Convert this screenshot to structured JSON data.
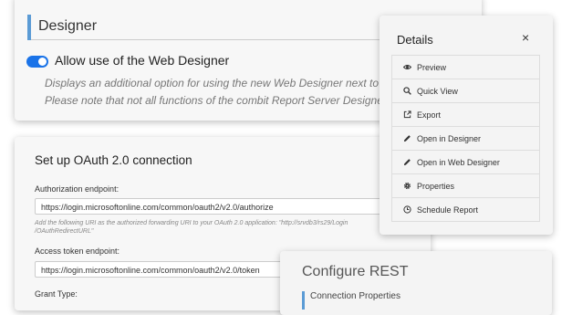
{
  "designer": {
    "title": "Designer",
    "toggle_label": "Allow use of the Web Designer",
    "desc_line1": "Displays an additional option for using the new Web Designer next to",
    "desc_line2": "Please note that not all functions of the combit Report Server Designer"
  },
  "oauth": {
    "title": "Set up OAuth 2.0 connection",
    "auth_label": "Authorization endpoint:",
    "auth_value": "https://login.microsoftonline.com/common/oauth2/v2.0/authorize",
    "hint": "Add the following URI as the authorized forwarding URI to your OAuth 2.0 application: \"http://srvdb3/rs29/Login /OAuthRedirectURL\"",
    "token_label": "Access token endpoint:",
    "token_value": "https://login.microsoftonline.com/common/oauth2/v2.0/token",
    "grant_label": "Grant Type:"
  },
  "rest": {
    "title": "Configure REST",
    "subtitle": "Connection Properties"
  },
  "details": {
    "title": "Details",
    "close": "×",
    "items": [
      {
        "label": "Preview",
        "icon": "eye-icon"
      },
      {
        "label": "Quick View",
        "icon": "magnifier-icon"
      },
      {
        "label": "Export",
        "icon": "export-icon"
      },
      {
        "label": "Open in Designer",
        "icon": "pencil-icon"
      },
      {
        "label": "Open in Web Designer",
        "icon": "pencil-icon"
      },
      {
        "label": "Properties",
        "icon": "gear-icon"
      },
      {
        "label": "Schedule Report",
        "icon": "clock-icon"
      }
    ]
  },
  "colors": {
    "accent": "#5b9bd5",
    "toggle": "#1a73e8"
  }
}
